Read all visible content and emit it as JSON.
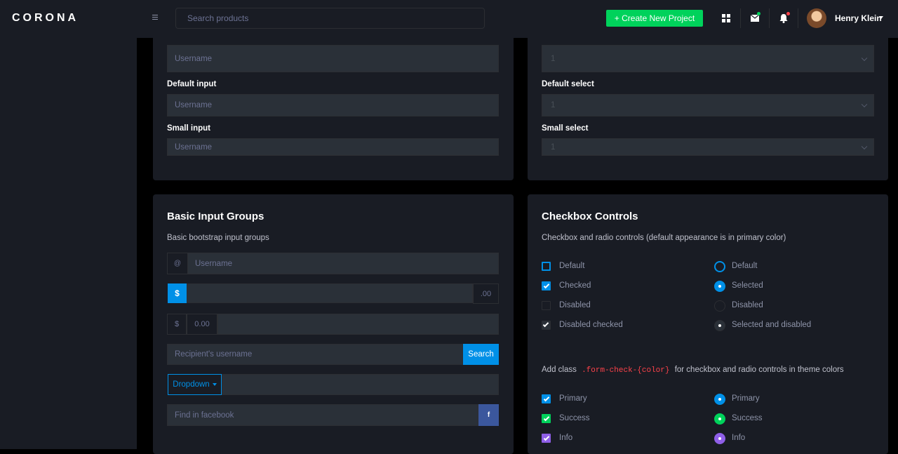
{
  "brand": "CORONA",
  "navbar": {
    "search_placeholder": "Search products",
    "create_button": "+ Create New Project",
    "user_name": "Henry Klein"
  },
  "input_sizes": {
    "large_value": "Username",
    "default_label": "Default input",
    "default_value": "Username",
    "small_label": "Small input",
    "small_value": "Username"
  },
  "select_sizes": {
    "large_value": "1",
    "default_label": "Default select",
    "default_value": "1",
    "small_label": "Small select",
    "small_value": "1"
  },
  "input_groups": {
    "title": "Basic Input Groups",
    "description": "Basic bootstrap input groups",
    "at_symbol": "@",
    "username_placeholder": "Username",
    "dollar_label": "$",
    "decimal_suffix": ".00",
    "dollar_label2": "$",
    "zero_value": "0.00",
    "recipient_placeholder": "Recipient's username",
    "search_button": "Search",
    "dropdown_button": "Dropdown",
    "facebook_placeholder": "Find in facebook",
    "facebook_letter": "f"
  },
  "checkbox_controls": {
    "title": "Checkbox Controls",
    "description": "Checkbox and radio controls (default appearance is in primary color)",
    "checkboxes": [
      "Default",
      "Checked",
      "Disabled",
      "Disabled checked"
    ],
    "radios": [
      "Default",
      "Selected",
      "Disabled",
      "Selected and disabled"
    ],
    "add_class_prefix": "Add class",
    "add_class_code": ".form-check-{color}",
    "add_class_suffix": "for checkbox and radio controls in theme colors",
    "theme_checkboxes": [
      "Primary",
      "Success",
      "Info"
    ],
    "theme_radios": [
      "Primary",
      "Success",
      "Info"
    ],
    "theme_colors": [
      "#0090e7",
      "#00d25b",
      "#8f5fe8"
    ]
  }
}
